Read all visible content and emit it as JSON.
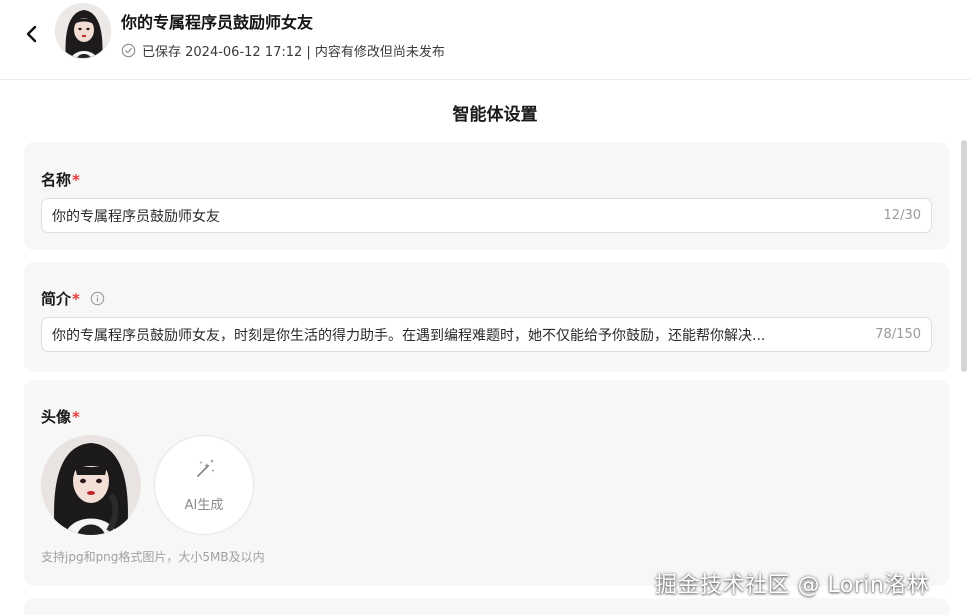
{
  "header": {
    "title": "你的专属程序员鼓励师女友",
    "status": "已保存 2024-06-12 17:12 | 内容有修改但尚未发布"
  },
  "page_title": "智能体设置",
  "name_section": {
    "label": "名称",
    "required_mark": "*",
    "value": "你的专属程序员鼓励师女友",
    "counter": "12/30"
  },
  "desc_section": {
    "label": "简介",
    "required_mark": "*",
    "value": "你的专属程序员鼓励师女友，时刻是你生活的得力助手。在遇到编程难题时，她不仅能给予你鼓励，还能帮你解决...",
    "counter": "78/150"
  },
  "avatar_section": {
    "label": "头像",
    "required_mark": "*",
    "ai_button_label": "AI生成",
    "hint": "支持jpg和png格式图片，大小5MB及以内"
  },
  "watermark": "掘金技术社区 @ Lorin洛林",
  "colors": {
    "required": "#e33b3b",
    "card_bg": "#f7f7f7",
    "muted_text": "#9a9a9a"
  }
}
